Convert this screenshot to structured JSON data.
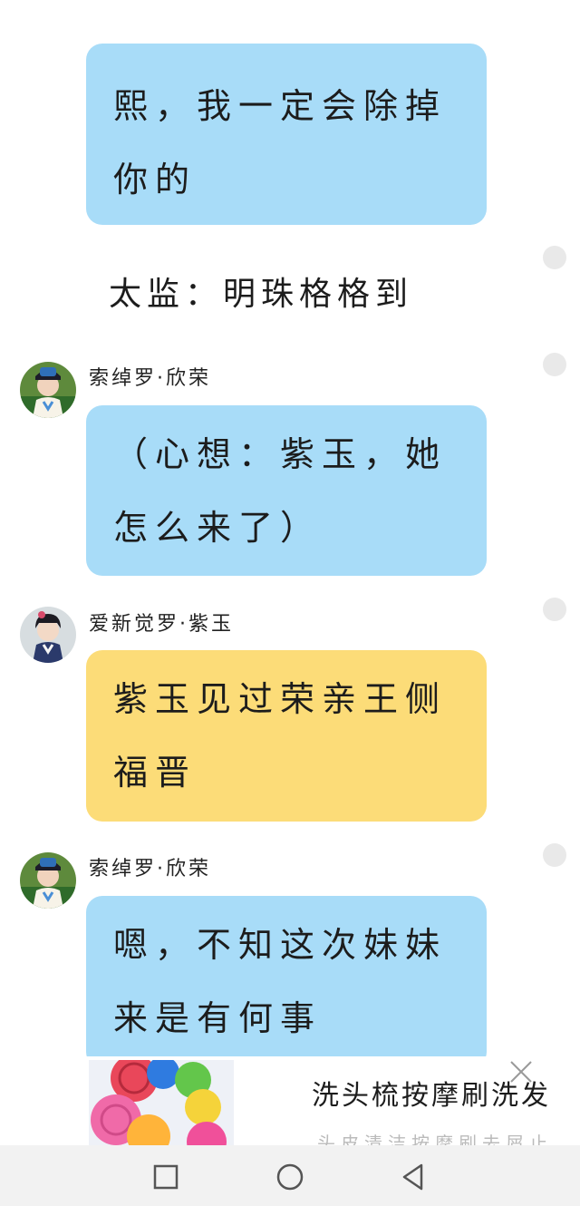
{
  "messages": {
    "m1": {
      "lines": [
        "熙，我一定会除掉",
        "你的"
      ]
    },
    "narration": "太监：明珠格格到",
    "m2": {
      "name": "索绰罗·欣荣",
      "lines": [
        "（心想：紫玉，她",
        "怎么来了）"
      ]
    },
    "m3": {
      "name": "爱新觉罗·紫玉",
      "lines": [
        "紫玉见过荣亲王侧",
        "福晋"
      ]
    },
    "m4": {
      "name": "索绰罗·欣荣",
      "lines": [
        "嗯，不知这次妹妹",
        "来是有何事"
      ]
    }
  },
  "colors": {
    "blue_bubble": "#a8dcf8",
    "yellow_bubble": "#fcdc78"
  },
  "ad": {
    "title": "洗头梳按摩刷洗发",
    "subtitle": "头皮清洁按摩刷去屑止痒",
    "close_icon": "close-icon"
  },
  "navbar": {
    "icons": [
      "recent-apps-icon",
      "home-icon",
      "back-icon"
    ]
  }
}
